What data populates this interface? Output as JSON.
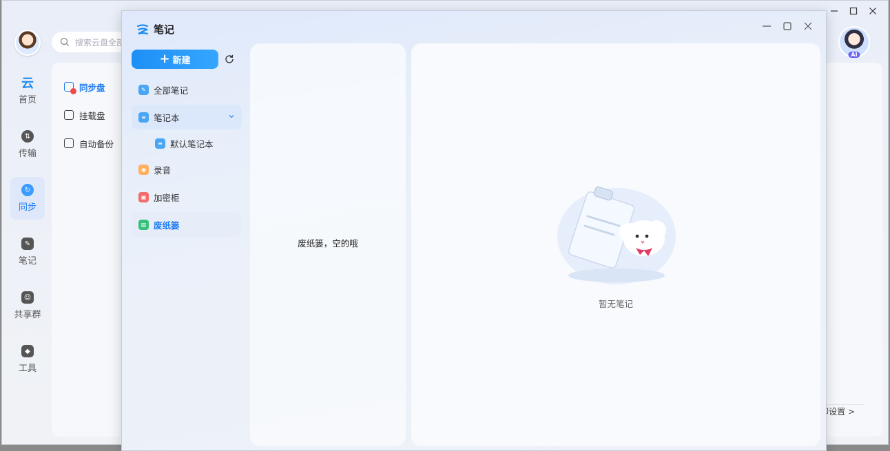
{
  "background_app": {
    "search_placeholder": "搜索云盘全部",
    "nav": [
      {
        "label": "首页",
        "icon": "cloud-logo-icon",
        "active": false
      },
      {
        "label": "传输",
        "icon": "transfer-icon",
        "active": false
      },
      {
        "label": "同步",
        "icon": "sync-icon",
        "active": true
      },
      {
        "label": "笔记",
        "icon": "pen-icon",
        "active": false
      },
      {
        "label": "共享群",
        "icon": "group-icon",
        "active": false
      },
      {
        "label": "工具",
        "icon": "toolbox-icon",
        "active": false
      }
    ],
    "subnav": [
      {
        "label": "同步盘",
        "icon": "sync-disk-icon",
        "active": true
      },
      {
        "label": "挂载盘",
        "icon": "mount-disk-icon",
        "active": false
      },
      {
        "label": "自动备份",
        "icon": "auto-backup-icon",
        "active": false
      }
    ],
    "ai_badge": "AI",
    "settings_link": "即设置 >"
  },
  "notes": {
    "title": "笔记",
    "new_button": "新建",
    "sidebar": [
      {
        "label": "全部笔记",
        "icon": "all-notes-icon",
        "color": "#4aa5f5"
      },
      {
        "label": "笔记本",
        "icon": "notebook-icon",
        "color": "#4aa5f5",
        "expanded": true
      },
      {
        "label": "默认笔记本",
        "icon": "notebook-icon",
        "color": "#4aa5f5",
        "child": true
      },
      {
        "label": "录音",
        "icon": "recording-icon",
        "color": "#ffb160"
      },
      {
        "label": "加密柜",
        "icon": "lock-icon",
        "color": "#f36b6b"
      },
      {
        "label": "废纸篓",
        "icon": "trash-icon",
        "color": "#35c07b",
        "active": true
      }
    ],
    "list_empty_text": "废纸篓，空的哦",
    "detail_empty_text": "暂无笔记"
  },
  "colors": {
    "accent": "#1f7cf0",
    "button_gradient_start": "#1e8ff5",
    "button_gradient_end": "#35a6ff"
  }
}
